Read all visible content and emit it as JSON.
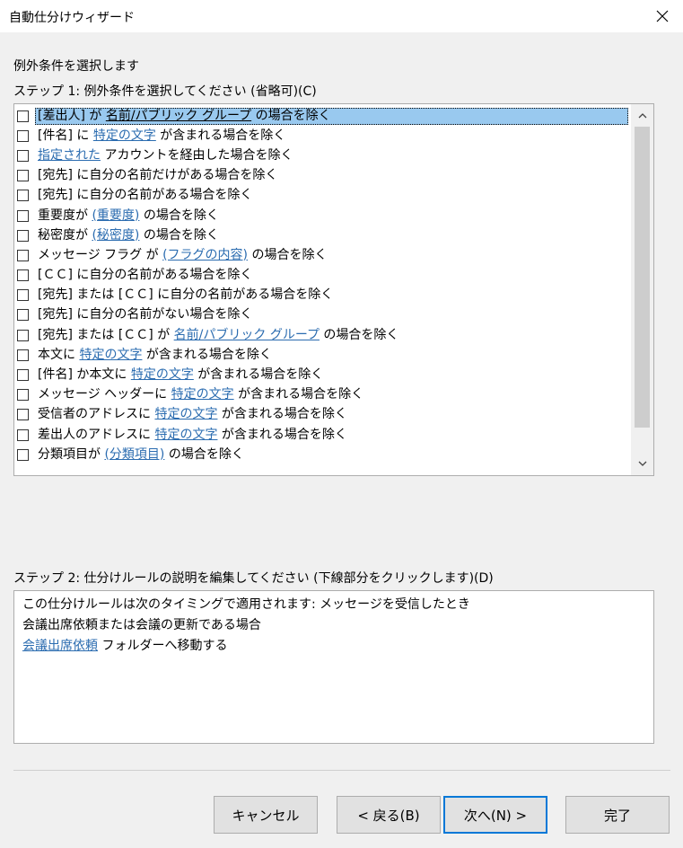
{
  "window": {
    "title": "自動仕分けウィザード"
  },
  "heading": "例外条件を選択します",
  "step1": {
    "label": "ステップ 1: 例外条件を選択してください (省略可)(C)"
  },
  "conditions": [
    {
      "parts": [
        {
          "t": "[差出人] が "
        },
        {
          "t": "名前/パブリック グループ",
          "link": true
        },
        {
          "t": " の場合を除く"
        }
      ],
      "checked": false,
      "selected": true
    },
    {
      "parts": [
        {
          "t": "[件名] に "
        },
        {
          "t": "特定の文字",
          "link": true
        },
        {
          "t": " が含まれる場合を除く"
        }
      ],
      "checked": false
    },
    {
      "parts": [
        {
          "t": "指定された",
          "link": true
        },
        {
          "t": " アカウントを経由した場合を除く"
        }
      ],
      "checked": false
    },
    {
      "parts": [
        {
          "t": "[宛先] に自分の名前だけがある場合を除く"
        }
      ],
      "checked": false
    },
    {
      "parts": [
        {
          "t": "[宛先] に自分の名前がある場合を除く"
        }
      ],
      "checked": false
    },
    {
      "parts": [
        {
          "t": "重要度が "
        },
        {
          "t": "(重要度)",
          "link": true
        },
        {
          "t": " の場合を除く"
        }
      ],
      "checked": false
    },
    {
      "parts": [
        {
          "t": "秘密度が "
        },
        {
          "t": "(秘密度)",
          "link": true
        },
        {
          "t": " の場合を除く"
        }
      ],
      "checked": false
    },
    {
      "parts": [
        {
          "t": "メッセージ フラグ が "
        },
        {
          "t": "(フラグの内容)",
          "link": true
        },
        {
          "t": " の場合を除く"
        }
      ],
      "checked": false
    },
    {
      "parts": [
        {
          "t": "[ＣＣ] に自分の名前がある場合を除く"
        }
      ],
      "checked": false
    },
    {
      "parts": [
        {
          "t": "[宛先] または [ＣＣ] に自分の名前がある場合を除く"
        }
      ],
      "checked": false
    },
    {
      "parts": [
        {
          "t": "[宛先] に自分の名前がない場合を除く"
        }
      ],
      "checked": false
    },
    {
      "parts": [
        {
          "t": "[宛先] または [ＣＣ] が "
        },
        {
          "t": "名前/パブリック グループ",
          "link": true
        },
        {
          "t": " の場合を除く"
        }
      ],
      "checked": false
    },
    {
      "parts": [
        {
          "t": "本文に "
        },
        {
          "t": "特定の文字",
          "link": true
        },
        {
          "t": " が含まれる場合を除く"
        }
      ],
      "checked": false
    },
    {
      "parts": [
        {
          "t": "[件名] か本文に "
        },
        {
          "t": "特定の文字",
          "link": true
        },
        {
          "t": " が含まれる場合を除く"
        }
      ],
      "checked": false
    },
    {
      "parts": [
        {
          "t": "メッセージ ヘッダーに "
        },
        {
          "t": "特定の文字",
          "link": true
        },
        {
          "t": " が含まれる場合を除く"
        }
      ],
      "checked": false
    },
    {
      "parts": [
        {
          "t": "受信者のアドレスに "
        },
        {
          "t": "特定の文字",
          "link": true
        },
        {
          "t": " が含まれる場合を除く"
        }
      ],
      "checked": false
    },
    {
      "parts": [
        {
          "t": "差出人のアドレスに "
        },
        {
          "t": "特定の文字",
          "link": true
        },
        {
          "t": " が含まれる場合を除く"
        }
      ],
      "checked": false
    },
    {
      "parts": [
        {
          "t": "分類項目が "
        },
        {
          "t": "(分類項目)",
          "link": true
        },
        {
          "t": " の場合を除く"
        }
      ],
      "checked": false
    }
  ],
  "step2": {
    "label": "ステップ 2: 仕分けルールの説明を編集してください (下線部分をクリックします)(D)"
  },
  "description": {
    "line1": "この仕分けルールは次のタイミングで適用されます: メッセージを受信したとき",
    "line2": "会議出席依頼または会議の更新である場合",
    "line3_link": "会議出席依頼",
    "line3_text": " フォルダーへ移動する"
  },
  "buttons": {
    "cancel": "キャンセル",
    "back": "< 戻る(B)",
    "next": "次へ(N) >",
    "finish": "完了"
  },
  "colors": {
    "link": "#2b6cb0",
    "selection": "#99c9ef",
    "default_button_border": "#0078d7"
  },
  "icons": {
    "close": "close-icon",
    "scroll_up": "chevron-up-icon",
    "scroll_down": "chevron-down-icon"
  }
}
